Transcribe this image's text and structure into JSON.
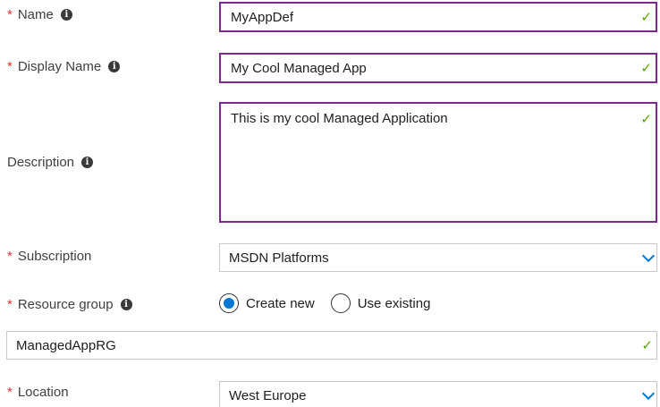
{
  "fields": {
    "name": {
      "label": "Name",
      "value": "MyAppDef"
    },
    "display_name": {
      "label": "Display Name",
      "value": "My Cool Managed App"
    },
    "description": {
      "label": "Description",
      "value": "This is my cool Managed Application"
    },
    "subscription": {
      "label": "Subscription",
      "value": "MSDN Platforms"
    },
    "resource_group": {
      "label": "Resource group",
      "options": [
        "Create new",
        "Use existing"
      ],
      "selected": "Create new",
      "value": "ManagedAppRG"
    },
    "location": {
      "label": "Location",
      "value": "West Europe"
    }
  },
  "symbols": {
    "required": "*",
    "info": "i",
    "check": "✓"
  },
  "colors": {
    "active_border": "#7a2a8e",
    "valid_check": "#57a300",
    "accent_blue": "#0078d4",
    "required_star": "#e03030"
  }
}
